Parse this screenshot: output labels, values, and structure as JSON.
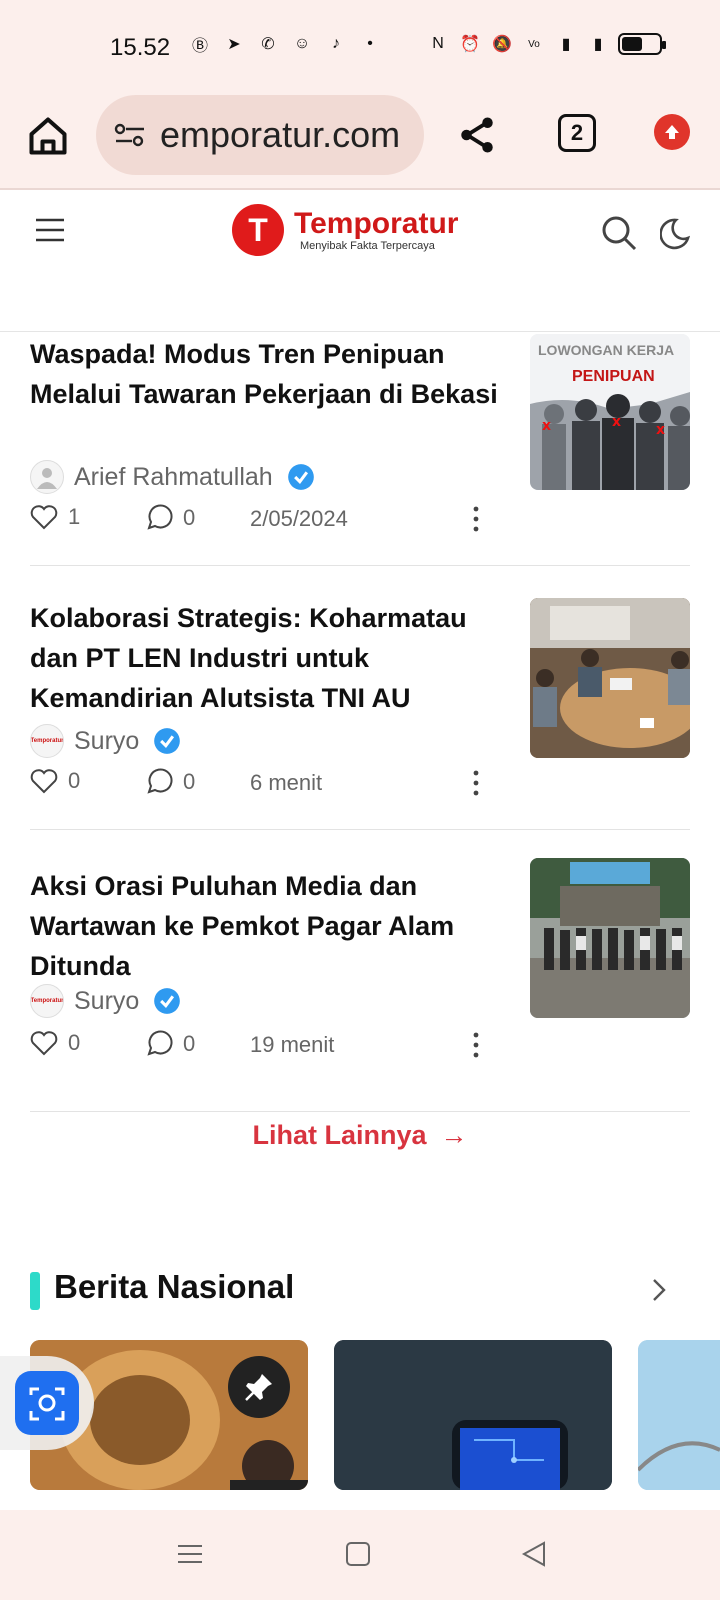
{
  "status": {
    "time": "15.52",
    "battery_level": 0.55
  },
  "browser": {
    "url": "emporatur.com",
    "tab_count": "2"
  },
  "site": {
    "name": "Temporatur",
    "tagline": "Menyibak Fakta Terpercaya",
    "logo_letter": "T"
  },
  "articles": [
    {
      "title": "Waspada! Modus Tren Penipuan Melalui Tawaran Pekerjaan di Bekasi",
      "author": "Arief Rahmatullah",
      "likes": "1",
      "comments": "0",
      "time": "2/05/2024",
      "thumb_text": [
        "LOWONGAN KERJA",
        "PENIPUAN"
      ]
    },
    {
      "title": "Kolaborasi Strategis: Koharmatau dan PT LEN Industri untuk Kemandirian Alutsista TNI AU",
      "author": "Suryo",
      "likes": "0",
      "comments": "0",
      "time": "6 menit"
    },
    {
      "title": "Aksi Orasi Puluhan Media dan Wartawan ke Pemkot Pagar Alam Ditunda",
      "author": "Suryo",
      "likes": "0",
      "comments": "0",
      "time": "19 menit"
    }
  ],
  "more_label": "Lihat Lainnya",
  "section": {
    "title": "Berita Nasional"
  },
  "colors": {
    "accent": "#d8343f",
    "brand": "#e01b1b",
    "section_bar": "#2ddac9",
    "chrome": "#fcefec"
  }
}
